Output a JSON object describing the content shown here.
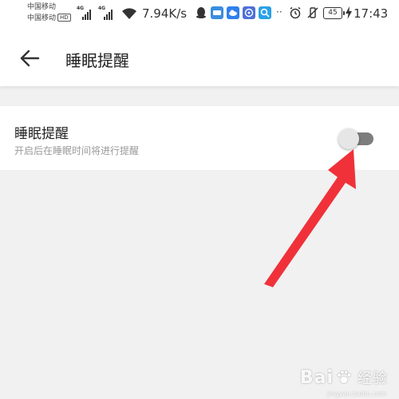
{
  "status_bar": {
    "carrier1": "中国移动",
    "carrier2": "中国移动",
    "hd_badge": "HD",
    "network1": "4G",
    "network2": "4G",
    "net_speed": "7.94K/s",
    "battery_level": "45",
    "time": "17:43",
    "notification_overflow": "··"
  },
  "app_bar": {
    "title": "睡眠提醒"
  },
  "setting": {
    "title": "睡眠提醒",
    "description": "开启后在睡眠时间将进行提醒",
    "enabled": false
  },
  "watermark": {
    "brand_left": "Bai",
    "brand_right": "经验",
    "sub": "jingyan.baidu.com"
  },
  "colors": {
    "background": "#f1f1f1",
    "surface": "#ffffff",
    "toggle_track_off": "#7d7d7d",
    "toggle_knob": "#e6e6e6",
    "annotation_arrow": "#f0313a"
  }
}
